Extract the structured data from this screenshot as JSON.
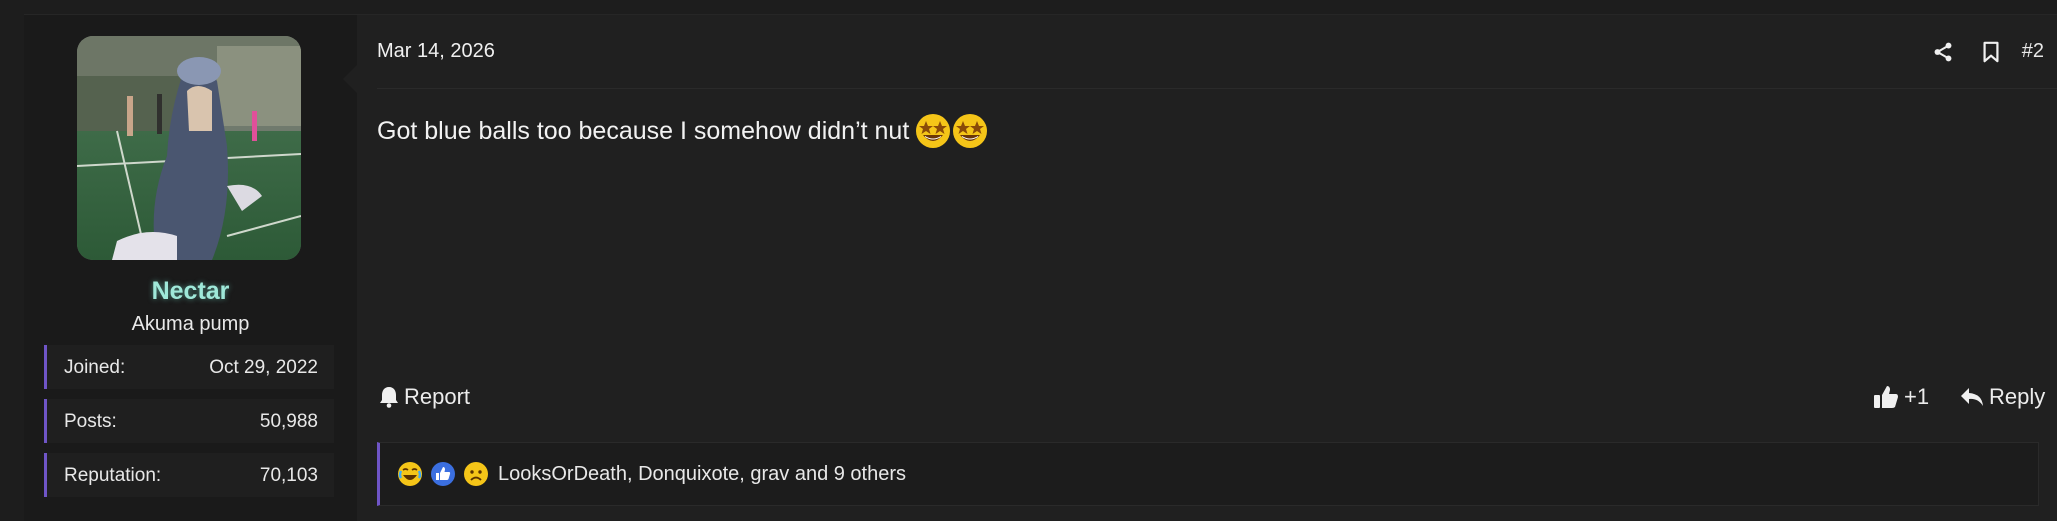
{
  "post": {
    "date": "Mar 14, 2026",
    "number": "#2",
    "body_text": "Got blue balls too because I somehow didn’t nut",
    "body_emojis": [
      "star-struck-emoji",
      "star-struck-emoji"
    ]
  },
  "user": {
    "username": "Nectar",
    "username_color": "#9fe8d9",
    "title": "Akuma pump",
    "stats": [
      {
        "label": "Joined:",
        "value": "Oct 29, 2022"
      },
      {
        "label": "Posts:",
        "value": "50,988"
      },
      {
        "label": "Reputation:",
        "value": "70,103"
      }
    ]
  },
  "actions": {
    "report_label": "Report",
    "like_label": "+1",
    "reply_label": "Reply"
  },
  "header_icons": [
    "share-icon",
    "bookmark-icon"
  ],
  "reactions": {
    "icons": [
      "laughing-crying-reaction-icon",
      "like-reaction-icon",
      "sad-reaction-icon"
    ],
    "text": "LooksOrDeath, Donquixote, grav and 9 others"
  },
  "colors": {
    "accent": "#6f55c7",
    "background": "#202020",
    "sidebar_background": "#1a1a1a"
  }
}
